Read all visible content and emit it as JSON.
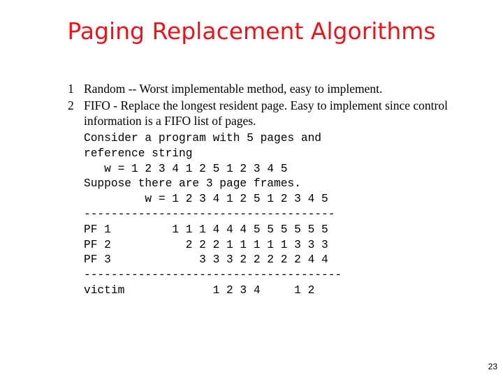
{
  "slide": {
    "title": "Paging Replacement Algorithms",
    "bullets": [
      {
        "num": "1",
        "text": "Random -- Worst implementable method, easy to implement."
      },
      {
        "num": "2",
        "text": "FIFO - Replace the longest resident page.  Easy to implement since control information is a FIFO list of pages."
      }
    ],
    "example_lines": [
      "Consider a program with 5 pages and",
      "reference string",
      "   w = 1 2 3 4 1 2 5 1 2 3 4 5",
      "Suppose there are 3 page frames.",
      "         w = 1 2 3 4 1 2 5 1 2 3 4 5",
      "-------------------------------------",
      "PF 1         1 1 1 4 4 4 5 5 5 5 5 5",
      "PF 2           2 2 2 1 1 1 1 1 3 3 3",
      "PF 3             3 3 3 2 2 2 2 2 4 4",
      "--------------------------------------",
      "victim             1 2 3 4     1 2"
    ],
    "reference_string": [
      1,
      2,
      3,
      4,
      1,
      2,
      5,
      1,
      2,
      3,
      4,
      5
    ],
    "page_frames": {
      "PF 1": [
        "1",
        "1",
        "1",
        "4",
        "4",
        "4",
        "5",
        "5",
        "5",
        "5",
        "5",
        "5"
      ],
      "PF 2": [
        "",
        "2",
        "2",
        "2",
        "1",
        "1",
        "1",
        "1",
        "1",
        "3",
        "3",
        "3"
      ],
      "PF 3": [
        "",
        "",
        "3",
        "3",
        "3",
        "2",
        "2",
        "2",
        "2",
        "2",
        "4",
        "4"
      ]
    },
    "victims": [
      "",
      "",
      "",
      "1",
      "2",
      "3",
      "4",
      "",
      "",
      "1",
      "2",
      ""
    ],
    "page_number": "23",
    "title_color": "#e8141b"
  }
}
